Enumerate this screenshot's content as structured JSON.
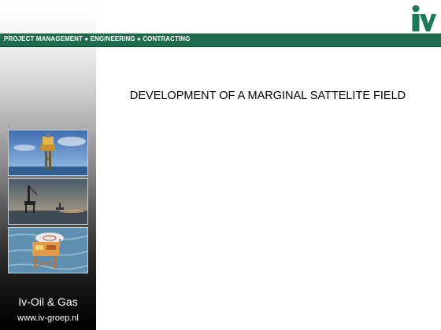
{
  "header": {
    "tagline": "PROJECT MANAGEMENT ● ENGINEERING ● CONTRACTING"
  },
  "slide": {
    "title": "DEVELOPMENT OF A MARGINAL SATTELITE FIELD"
  },
  "sidebar": {
    "company": "Iv-Oil & Gas",
    "website": "www.iv-groep.nl"
  },
  "colors": {
    "brand_green": "#1f6b4d",
    "logo_green": "#1b7a55"
  },
  "images": [
    {
      "name": "offshore-platform-blue-sky-photo"
    },
    {
      "name": "offshore-rig-at-sunset-photo"
    },
    {
      "name": "offshore-platform-with-helideck-photo"
    }
  ]
}
